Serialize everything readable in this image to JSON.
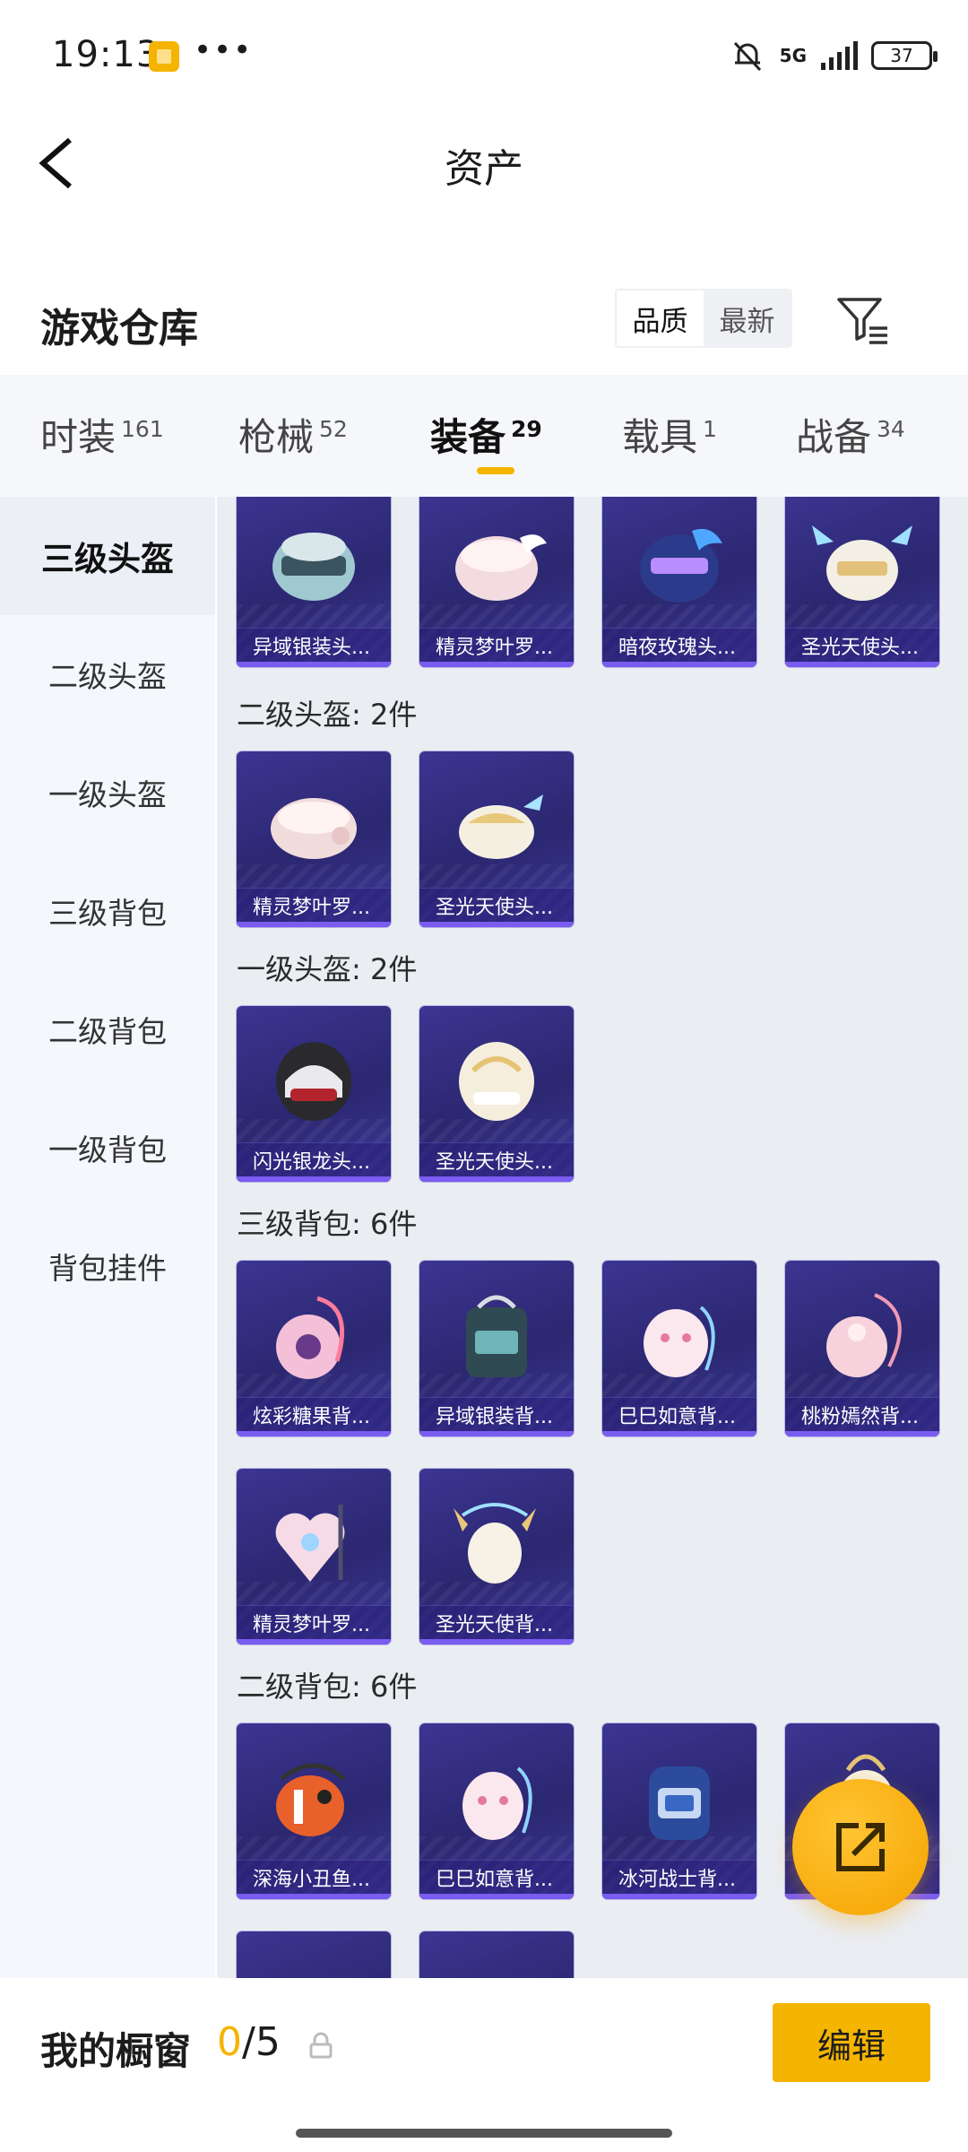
{
  "status": {
    "time": "19:13",
    "more": "•••",
    "network": "5G",
    "battery": "37"
  },
  "header": {
    "title": "资产"
  },
  "warehouse": {
    "title": "游戏仓库",
    "sort": [
      "品质",
      "最新"
    ]
  },
  "tabs": [
    {
      "label": "时装",
      "count": "161"
    },
    {
      "label": "枪械",
      "count": "52"
    },
    {
      "label": "装备",
      "count": "29"
    },
    {
      "label": "载具",
      "count": "1"
    },
    {
      "label": "战备",
      "count": "34"
    }
  ],
  "sidebar": [
    "三级头盔",
    "二级头盔",
    "一级头盔",
    "三级背包",
    "二级背包",
    "一级背包",
    "背包挂件"
  ],
  "sections": [
    {
      "label": "",
      "items": [
        "异域银装头...",
        "精灵梦叶罗...",
        "暗夜玫瑰头...",
        "圣光天使头..."
      ]
    },
    {
      "label": "二级头盔: 2件",
      "items": [
        "精灵梦叶罗...",
        "圣光天使头..."
      ]
    },
    {
      "label": "一级头盔: 2件",
      "items": [
        "闪光银龙头...",
        "圣光天使头..."
      ]
    },
    {
      "label": "三级背包: 6件",
      "items": [
        "炫彩糖果背...",
        "异域银装背...",
        "巳巳如意背...",
        "桃粉嫣然背...",
        "精灵梦叶罗...",
        "圣光天使背..."
      ]
    },
    {
      "label": "二级背包: 6件",
      "items": [
        "深海小丑鱼...",
        "巳巳如意背...",
        "冰河战士背...",
        ""
      ]
    }
  ],
  "bottom": {
    "title": "我的橱窗",
    "current": "0",
    "total": "/5",
    "edit": "编辑"
  },
  "colors": {
    "accent": "#f5b400",
    "card_bg": "#2b2770",
    "card_stripe": "#7b5cf0"
  }
}
